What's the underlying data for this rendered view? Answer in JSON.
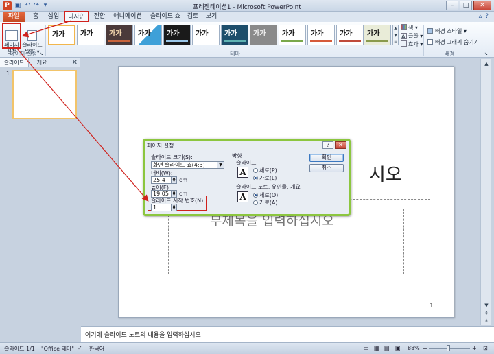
{
  "window": {
    "title": "프레젠테이션1 - Microsoft PowerPoint",
    "app_icon_letter": "P",
    "quick_access": [
      "save-icon",
      "undo-icon",
      "redo-icon",
      "customize-icon"
    ],
    "buttons": {
      "minimize": "–",
      "maximize": "□",
      "close": "✕"
    }
  },
  "tabs": {
    "file": "파일",
    "items": [
      "홈",
      "삽입",
      "디자인",
      "전환",
      "애니메이션",
      "슬라이드 쇼",
      "검토",
      "보기"
    ],
    "active": "디자인",
    "right_icons": [
      "minimize-ribbon-icon",
      "help-icon"
    ]
  },
  "ribbon": {
    "page_setup": {
      "page_setup_label": "페이지\n설정",
      "orientation_label": "슬라이드\n방향 ▾",
      "group_label": "페이지 설정"
    },
    "themes": {
      "group_label": "테마",
      "thumb_text": [
        "가가",
        "가가",
        "가가",
        "가가",
        "가가",
        "가가",
        "가가",
        "가가",
        "가가",
        "가가",
        "가가",
        "가가"
      ],
      "options": [
        "색 ▾",
        "글꼴 ▾",
        "효과 ▾"
      ]
    },
    "background": {
      "group_label": "배경",
      "styles_label": "배경 스타일 ▾",
      "hide_graphics_label": "배경 그래픽 숨기기"
    }
  },
  "left_pane": {
    "tabs": [
      "슬라이드",
      "개요"
    ],
    "close": "✕",
    "slide_number": "1"
  },
  "slide": {
    "title_placeholder_visible": "시오",
    "subtitle_placeholder": "부제목을 입력하십시오",
    "page_number": "1"
  },
  "notes": {
    "placeholder": "여기에 슬라이드 노트의 내용을 입력하십시오"
  },
  "status_bar": {
    "slide_info": "슬라이드 1/1",
    "theme": "\"Office 테마\"",
    "language": "한국어",
    "zoom": "88%",
    "zoom_minus": "−",
    "zoom_plus": "+"
  },
  "dialog": {
    "title": "페이지 설정",
    "help": "?",
    "close": "✕",
    "slide_size_label": "슬라이드 크기(S):",
    "slide_size_value": "화면 슬라이드 쇼(4:3)",
    "width_label": "너비(W):",
    "width_value": "25.4",
    "width_unit": "cm",
    "height_label": "높이(E):",
    "height_value": "19.05",
    "height_unit": "cm",
    "start_number_label": "슬라이드 시작 번호(N):",
    "start_number_value": "1",
    "orientation_label": "방향",
    "slides_label": "슬라이드",
    "slides_portrait": "세로(P)",
    "slides_landscape": "가로(L)",
    "notes_label": "슬라이드 노트, 유인물, 개요",
    "notes_portrait": "세로(O)",
    "notes_landscape": "가로(A)",
    "ok": "확인",
    "cancel": "취소"
  },
  "colors": {
    "file_tab": "#d24726",
    "highlight": "#d0221d",
    "dialog_border": "#8cc63f",
    "accent": "#2b5797"
  }
}
